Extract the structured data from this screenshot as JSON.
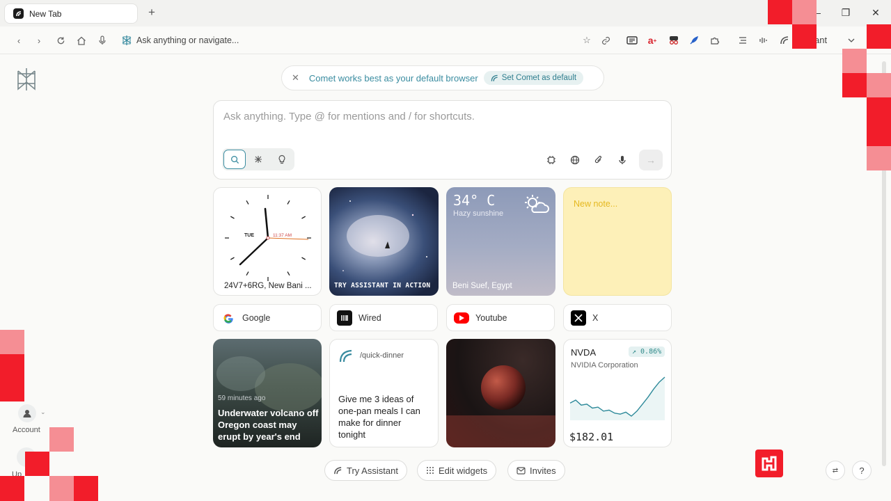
{
  "tab": {
    "title": "New Tab"
  },
  "toolbar": {
    "omnibox_placeholder": "Ask anything or navigate...",
    "assistant_label": "ant"
  },
  "banner": {
    "text": "Comet works best as your default browser",
    "button": "Set Comet as default"
  },
  "search": {
    "placeholder": "Ask anything. Type @ for mentions and / for shortcuts."
  },
  "widgets": {
    "clock": {
      "day": "TUE",
      "time": "11:37 AM",
      "location": "24V7+6RG, New Bani ..."
    },
    "promo": {
      "label": "TRY ASSISTANT IN ACTION"
    },
    "weather": {
      "temp": "34° C",
      "condition": "Hazy sunshine",
      "location": "Beni Suef, Egypt"
    },
    "note": {
      "placeholder": "New note..."
    },
    "news": {
      "age": "59 minutes ago",
      "headline": "Underwater volcano off Oregon coast may erupt by year's end"
    },
    "shortcut": {
      "command": "/quick-dinner",
      "prompt": "Give me 3 ideas of one-pan meals I can make for dinner tonight"
    },
    "stock": {
      "ticker": "NVDA",
      "change": "↗ 0.86%",
      "company": "NVIDIA Corporation",
      "price": "$182.01",
      "trend": [
        182.0,
        182.3,
        181.8,
        181.9,
        181.5,
        181.6,
        181.2,
        181.3,
        181.0,
        180.9,
        181.1,
        180.7,
        181.2,
        181.9,
        182.6,
        183.4,
        184.1,
        184.6
      ]
    }
  },
  "sites": [
    {
      "name": "Google"
    },
    {
      "name": "Wired"
    },
    {
      "name": "Youtube"
    },
    {
      "name": "X"
    }
  ],
  "sidebar": {
    "account_label": "Account",
    "update_label": "Up"
  },
  "footer": {
    "try_assistant": "Try Assistant",
    "edit_widgets": "Edit widgets",
    "invites": "Invites"
  },
  "colors": {
    "accent": "#3a8ca0",
    "overlay_red": "#f21d2a",
    "overlay_pink": "#f58e94"
  }
}
